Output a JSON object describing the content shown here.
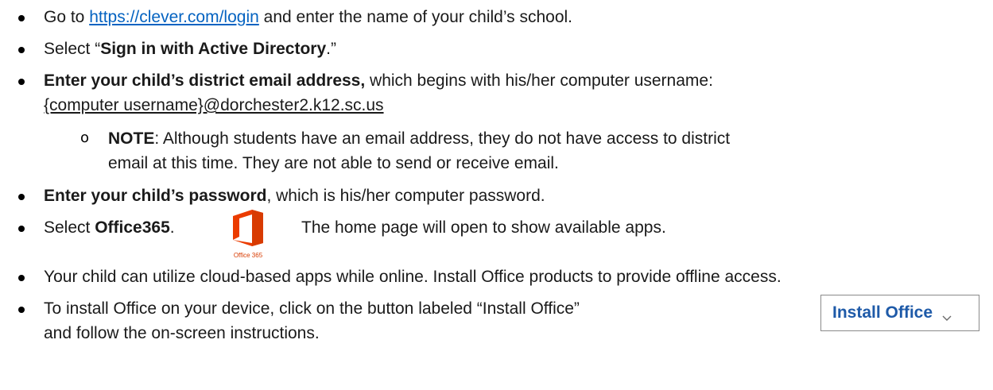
{
  "items": [
    {
      "pre": "Go to ",
      "link": "https://clever.com/login",
      "post": " and enter the name of your child’s school."
    },
    {
      "pre": "Select “",
      "bold": "Sign in with Active Directory",
      "post": ".”"
    },
    {
      "bold": "Enter your child’s district email address,",
      "post": " which begins with his/her computer username:",
      "line2": "{computer username}@dorchester2.k12.sc.us"
    },
    {
      "bold": "NOTE",
      "post": ": Although students have an email address, they do not have access to district",
      "line2": "email at this time. They are not able to send or receive email."
    },
    {
      "bold": "Enter your child’s password",
      "post": ", which is his/her computer password."
    },
    {
      "pre": "Select ",
      "bold": "Office365",
      "post": ".",
      "after_logo": "The home page will open to show available apps.",
      "logo_caption": "Office 365"
    },
    {
      "text": "Your child can utilize cloud-based apps while online. Install Office products to provide offline access."
    },
    {
      "text": "To install Office on your device, click on the button labeled “Install Office”",
      "line2": "and follow the on-screen instructions."
    }
  ],
  "install_button": {
    "label": "Install Office",
    "icon": "chevron-down-icon"
  },
  "colors": {
    "link": "#0563c1",
    "office_orange": "#d83b01",
    "button_text": "#1e5aa8"
  }
}
